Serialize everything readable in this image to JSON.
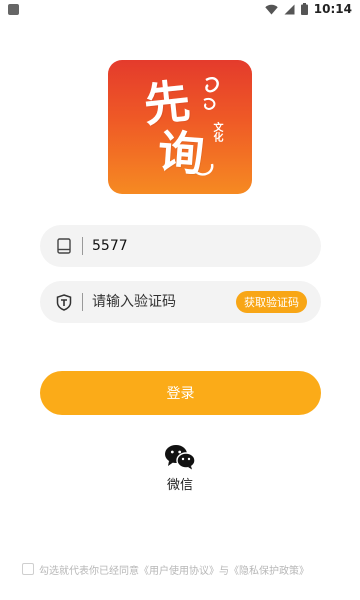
{
  "status_bar": {
    "time": "10:14"
  },
  "logo": {
    "char1": "先",
    "char2": "询",
    "small": "文化",
    "colors": [
      "#e43b2c",
      "#f68a22"
    ]
  },
  "phone": {
    "value": "5577",
    "icon": "tablet-icon"
  },
  "code": {
    "placeholder": "请输入验证码",
    "icon": "shield-t-icon",
    "get_code_label": "获取验证码"
  },
  "login": {
    "label": "登录",
    "color": "#fbab18"
  },
  "wechat": {
    "label": "微信",
    "icon": "wechat-icon"
  },
  "agreement": {
    "prefix": "勾选就代表你已经同意",
    "user_agreement": "《用户使用协议》",
    "joiner": "与",
    "privacy_policy": "《隐私保护政策》"
  }
}
